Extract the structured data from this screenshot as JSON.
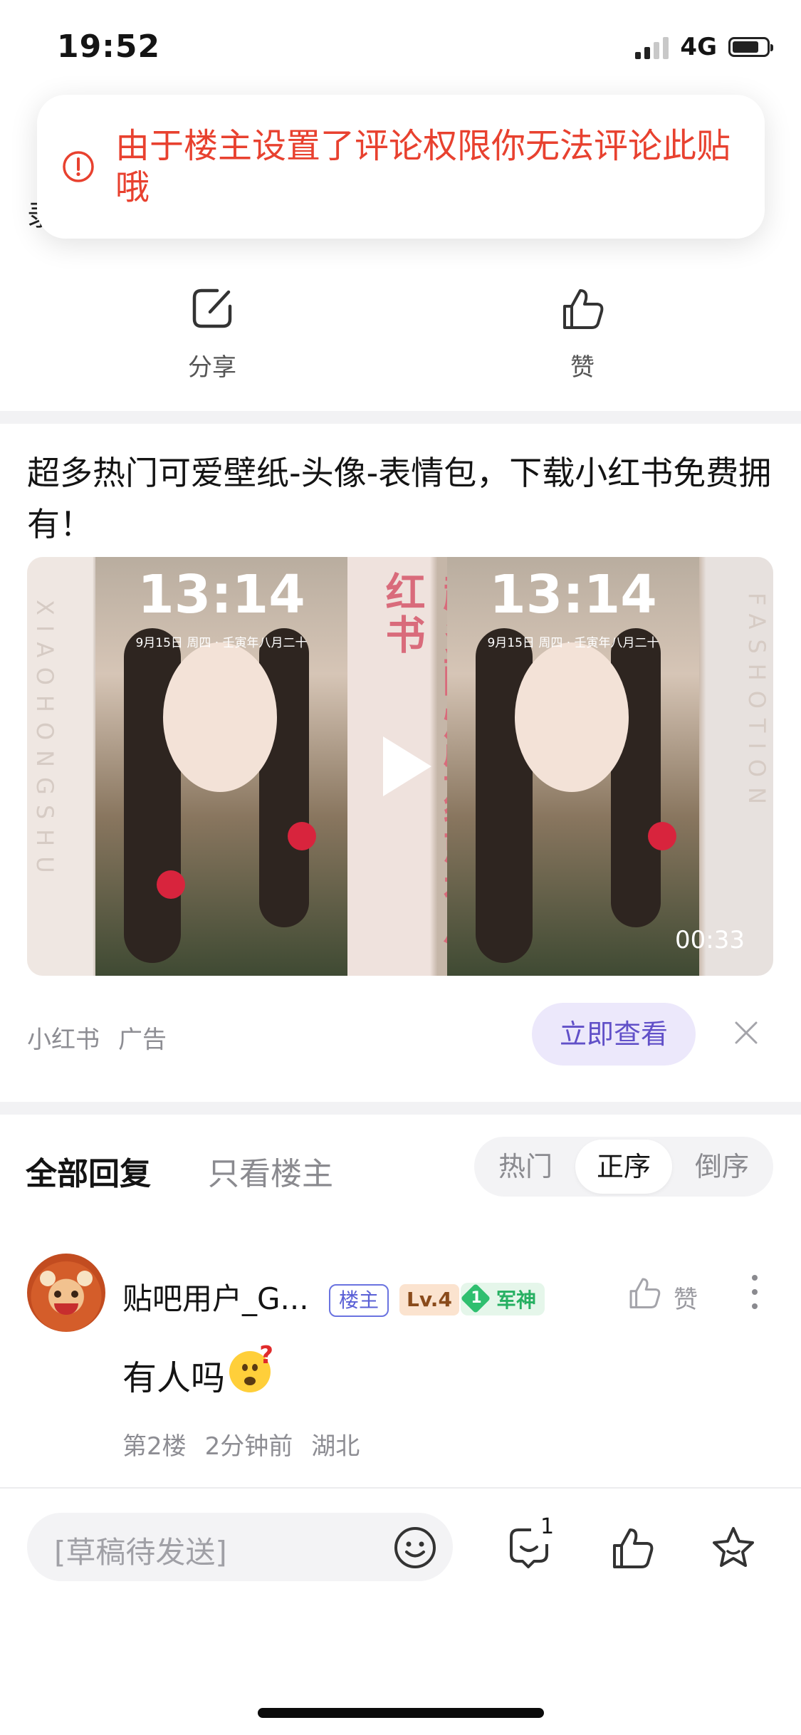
{
  "status_bar": {
    "time": "19:52",
    "network": "4G"
  },
  "toast": {
    "message": "由于楼主设置了评论权限你无法评论此贴哦",
    "icon": "warning-circle-icon",
    "color": "#e8412f"
  },
  "peek_text": "录",
  "actions": {
    "share_label": "分享",
    "like_label": "赞"
  },
  "ad": {
    "title": "超多热门可爱壁纸-头像-表情包，下载小红书免费拥有！",
    "media": {
      "clock": "13:14",
      "date": "9月15日 周四 · 壬寅年八月二十",
      "vertical_slogan": "超多酷炫壁纸就在小红书",
      "side_text_left": "XIAOHONGSHU",
      "side_text_right": "FASHOTION",
      "duration": "00:33"
    },
    "source": "小红书",
    "tag": "广告",
    "cta": "立即查看"
  },
  "replies": {
    "tab_all": "全部回复",
    "tab_op_only": "只看楼主",
    "sort_options": [
      "热门",
      "正序",
      "倒序"
    ],
    "sort_selected": "正序"
  },
  "comment": {
    "username": "贴吧用户_G...",
    "op_badge": "楼主",
    "level": "Lv.4",
    "rank_num": "1",
    "rank_title": "军神",
    "like_label": "赞",
    "text": "有人吗",
    "floor": "第2楼",
    "time_ago": "2分钟前",
    "location": "湖北"
  },
  "bottom_bar": {
    "draft_placeholder": "[草稿待发送]",
    "reply_count": "1"
  },
  "colors": {
    "accent_purple": "#6150c8",
    "warning_red": "#e8412f",
    "rank_green": "#27b062"
  }
}
